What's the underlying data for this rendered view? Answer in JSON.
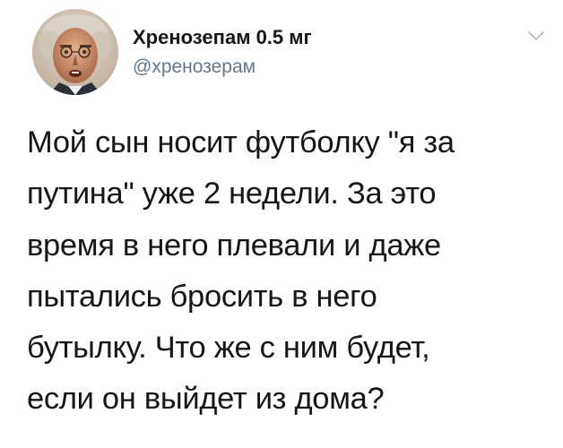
{
  "tweet": {
    "author": {
      "display_name": "Хренозепам 0.5 мг",
      "handle": "@хренозерам"
    },
    "text": "Мой сын носит футболку \"я за\nпутина\" уже 2 недели. За это\nвремя в него плевали и даже\nпытались бросить в него\nбутылку. Что же с ним будет,\nесли он выйдет из дома?",
    "icons": {
      "avatar": "avatar",
      "menu": "chevron-down-icon"
    },
    "colors": {
      "name": "#14171a",
      "handle": "#657786",
      "caret": "#aab8c2"
    }
  }
}
